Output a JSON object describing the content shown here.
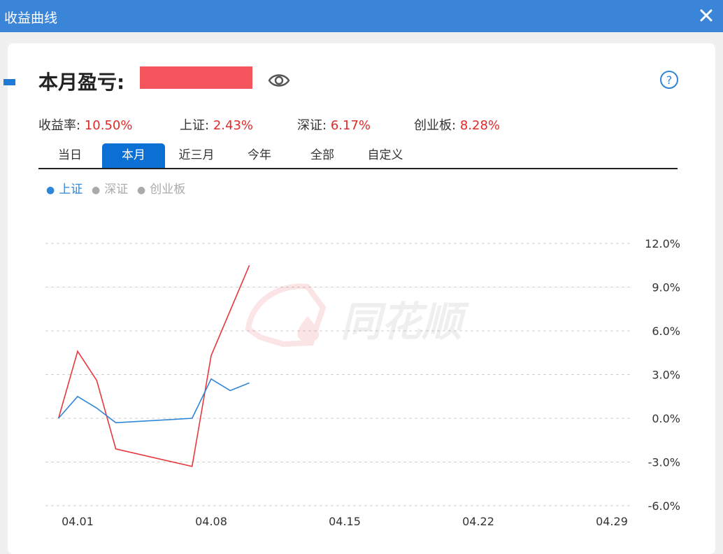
{
  "window": {
    "title": "收益曲线"
  },
  "summary": {
    "label": "本月盈亏:",
    "stats": [
      {
        "label": "收益率:",
        "value": "10.50%"
      },
      {
        "label": "上证:",
        "value": "2.43%"
      },
      {
        "label": "深证:",
        "value": "6.17%"
      },
      {
        "label": "创业板:",
        "value": "8.28%"
      }
    ]
  },
  "tabs": [
    {
      "label": "当日",
      "active": false
    },
    {
      "label": "本月",
      "active": true
    },
    {
      "label": "近三月",
      "active": false
    },
    {
      "label": "今年",
      "active": false
    },
    {
      "label": "全部",
      "active": false
    },
    {
      "label": "自定义",
      "active": false
    }
  ],
  "legend": [
    {
      "label": "上证",
      "active": true,
      "color": "#2f86d6"
    },
    {
      "label": "深证",
      "active": false,
      "color": "#aaaaaa"
    },
    {
      "label": "创业板",
      "active": false,
      "color": "#aaaaaa"
    }
  ],
  "watermark": {
    "text": "同花顺"
  },
  "colors": {
    "accent": "#0a70d4",
    "titlebar": "#3a85d8",
    "positive": "#e02a2a",
    "series_blue": "#2f86d6",
    "series_red": "#e8383d"
  },
  "chart_data": {
    "type": "line",
    "x_ticks": [
      "04.01",
      "04.08",
      "04.15",
      "04.22",
      "04.29"
    ],
    "y_ticks": [
      "12.0%",
      "9.0%",
      "6.0%",
      "3.0%",
      "0.0%",
      "-3.0%",
      "-6.0%"
    ],
    "ylim": [
      -6.0,
      12.0
    ],
    "series": [
      {
        "color": "#e8383d",
        "points": [
          {
            "x": "03.31",
            "y": 0.0
          },
          {
            "x": "04.01",
            "y": 4.6
          },
          {
            "x": "04.02",
            "y": 2.6
          },
          {
            "x": "04.03",
            "y": -2.1
          },
          {
            "x": "04.07",
            "y": -3.3
          },
          {
            "x": "04.08",
            "y": 4.3
          },
          {
            "x": "04.10",
            "y": 10.5
          }
        ]
      },
      {
        "name": "上证",
        "color": "#2f86d6",
        "points": [
          {
            "x": "03.31",
            "y": 0.0
          },
          {
            "x": "04.01",
            "y": 1.5
          },
          {
            "x": "04.02",
            "y": 0.7
          },
          {
            "x": "04.03",
            "y": -0.3
          },
          {
            "x": "04.07",
            "y": 0.0
          },
          {
            "x": "04.08",
            "y": 2.7
          },
          {
            "x": "04.09",
            "y": 1.9
          },
          {
            "x": "04.10",
            "y": 2.43
          }
        ]
      }
    ]
  }
}
